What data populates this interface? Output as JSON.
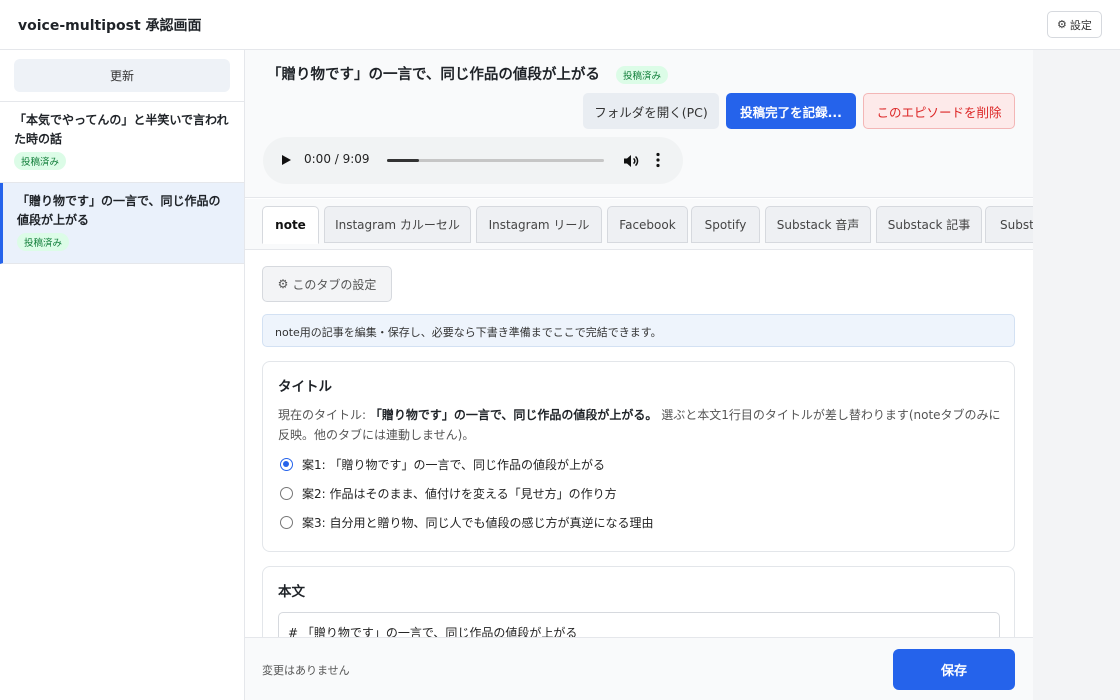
{
  "app": {
    "title": "voice-multipost 承認画面",
    "settings_label": "設定"
  },
  "sidebar": {
    "refresh_label": "更新",
    "episodes": [
      {
        "title": "「本気でやってんの」と半笑いで言われた時の話",
        "status": "投稿済み"
      },
      {
        "title": "「贈り物です」の一言で、同じ作品の値段が上がる",
        "status": "投稿済み"
      }
    ]
  },
  "episode": {
    "title": "「贈り物です」の一言で、同じ作品の値段が上がる",
    "status": "投稿済み",
    "actions": {
      "open_folder": "フォルダを開く(PC)",
      "record_post": "投稿完了を記録...",
      "delete": "このエピソードを削除"
    },
    "audio": {
      "time": "0:00 / 9:09",
      "progress": 0.0
    }
  },
  "tabs": [
    "note",
    "Instagram カルーセル",
    "Instagram リール",
    "Facebook",
    "Spotify",
    "Substack 音声",
    "Substack 記事",
    "Substack"
  ],
  "active_tab": "note",
  "tab_content": {
    "tab_settings_label": "このタブの設定",
    "info": "note用の記事を編集・保存し、必要なら下書き準備までここで完結できます。",
    "title_section": {
      "heading": "タイトル",
      "current_prefix": "現在のタイトル: ",
      "current_title": "「贈り物です」の一言で、同じ作品の値段が上がる。",
      "note": " 選ぶと本文1行目のタイトルが差し替わります(noteタブのみに反映。他のタブには連動しません)。",
      "options": [
        "案1: 「贈り物です」の一言で、同じ作品の値段が上がる",
        "案2: 作品はそのまま、値付けを変える「見せ方」の作り方",
        "案3: 自分用と贈り物、同じ人でも値段の感じ方が真逆になる理由"
      ],
      "selected_index": 0
    },
    "body_section": {
      "heading": "本文",
      "first_line": "# 「贈り物です」の一言で、同じ作品の値段が上がる"
    }
  },
  "footer": {
    "status": "変更はありません",
    "save_label": "保存"
  },
  "colors": {
    "accent": "#2563eb",
    "success_bg": "#dcfce7",
    "success_text": "#15803d",
    "danger": "#dc2626"
  },
  "icons": {
    "settings": "gear-icon",
    "play": "play-icon",
    "volume": "volume-icon",
    "more": "more-vertical-icon"
  }
}
